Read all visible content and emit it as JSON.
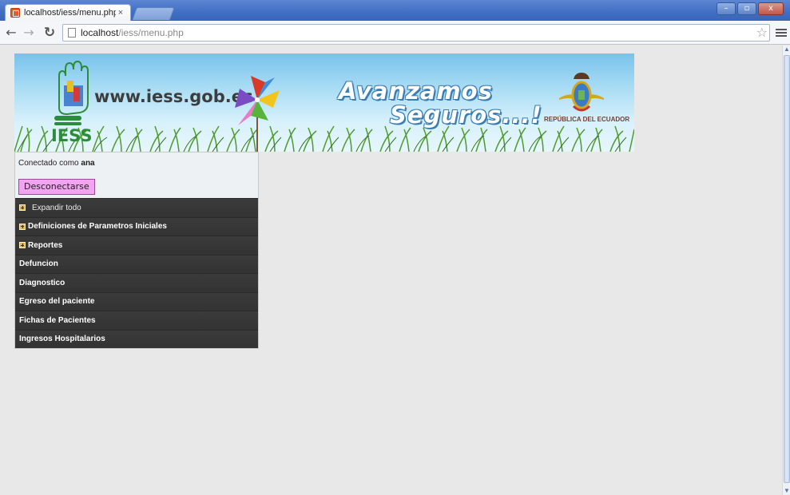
{
  "browser": {
    "tab_title": "localhost/iess/menu.php",
    "tab_close": "×",
    "url_host": "localhost",
    "url_path": "/iess/menu.php",
    "window_min": "–",
    "window_max": "▫",
    "window_close": "x"
  },
  "banner": {
    "site_url": "www.iess.gob.ec",
    "logo_text": "IESS",
    "slogan_line1": "Avanzamos",
    "slogan_line2": "Seguros...!",
    "country_text": "REPÚBLICA DEL ECUADOR"
  },
  "session": {
    "prefix": "Conectado como",
    "username": "ana",
    "logout_label": "Desconectarse"
  },
  "menu": {
    "expand_all": "Expandir todo",
    "items": [
      {
        "label": "Definiciones de Parametros Iniciales"
      },
      {
        "label": "Reportes"
      },
      {
        "label": "Defuncion"
      },
      {
        "label": "Diagnostico"
      },
      {
        "label": "Egreso del paciente"
      },
      {
        "label": "Fichas de Pacientes"
      },
      {
        "label": "Ingresos Hospitalarios"
      }
    ]
  },
  "colors": {
    "titlebar": "#3f6ec4",
    "menu_bg": "#353535",
    "logout_button": "#f2a4f0",
    "page_bg": "#e8e8e8"
  }
}
